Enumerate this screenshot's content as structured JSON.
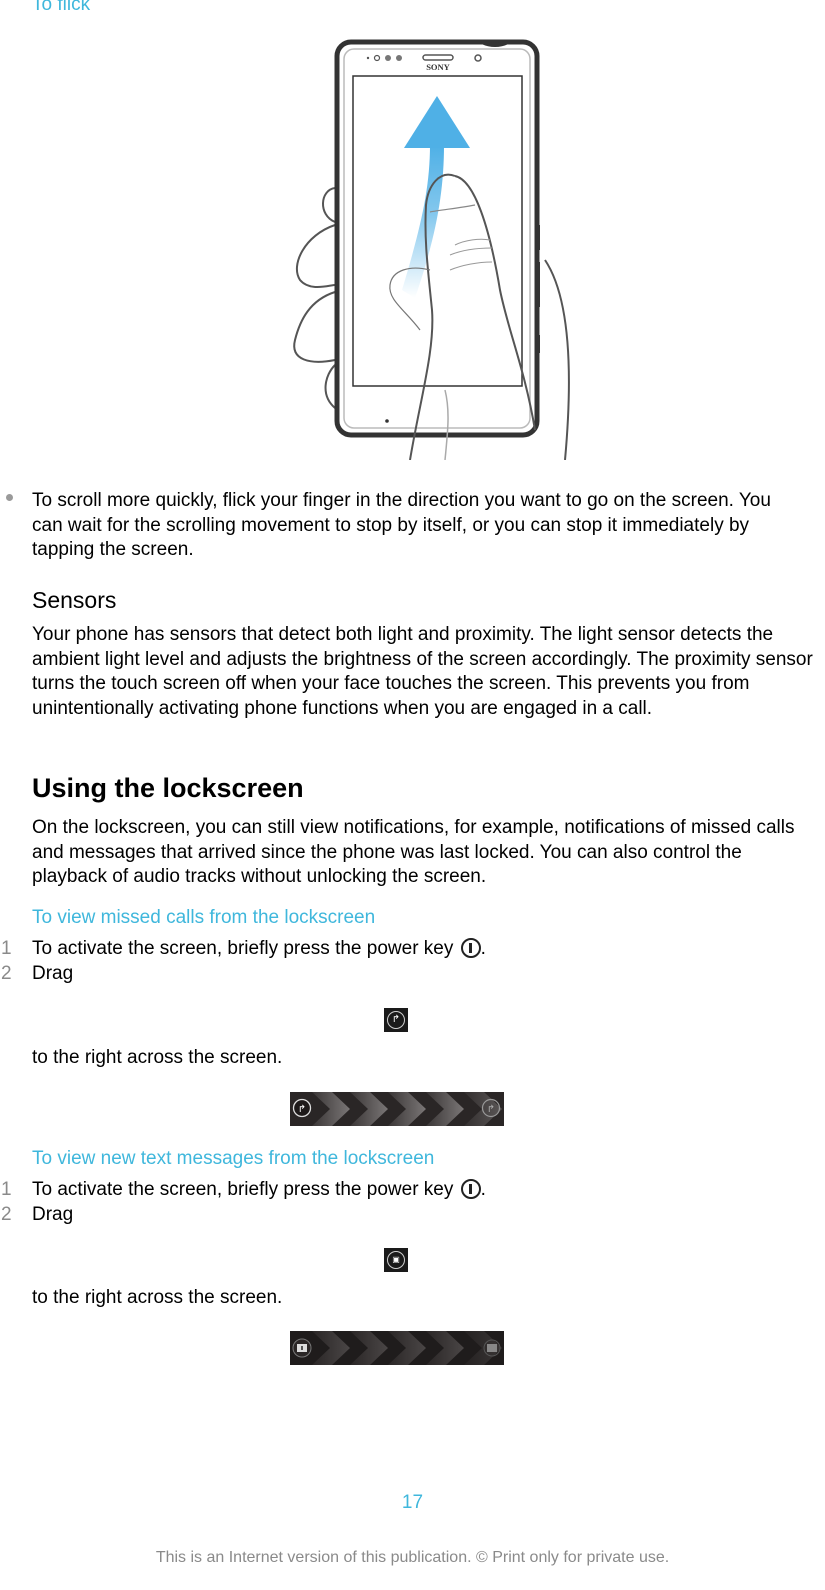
{
  "headings": {
    "to_flick": "To flick",
    "sensors": "Sensors",
    "using_lockscreen": "Using the lockscreen"
  },
  "illustration": {
    "brand_label": "SONY",
    "arrow_color": "#4fb0e6",
    "description": "Hand holding phone with finger flicking upward"
  },
  "bullets": [
    "To scroll more quickly, flick your finger in the direction you want to go on the screen. You can wait for the scrolling movement to stop by itself, or you can stop it immediately by tapping the screen."
  ],
  "paragraphs": {
    "sensors": "Your phone has sensors that detect both light and proximity. The light sensor detects the ambient light level and adjusts the brightness of the screen accordingly. The proximity sensor turns the touch screen off when your face touches the screen. This prevents you from unintentionally activating phone functions when you are engaged in a call.",
    "lockscreen": "On the lockscreen, you can still view notifications, for example, notifications of missed calls and messages that arrived since the phone was last locked. You can also control the playback of audio tracks without unlocking the screen."
  },
  "procedures": [
    {
      "title": "To view missed calls from the lockscreen",
      "steps": [
        {
          "num": "1",
          "text": "To activate the screen, briefly press the power key",
          "suffix": "."
        },
        {
          "num": "2",
          "text": "Drag"
        }
      ],
      "after_icon_text": "to the right across the screen.",
      "icon": "missed-call-icon",
      "icon_glyph": "↱"
    },
    {
      "title": "To view new text messages from the lockscreen",
      "steps": [
        {
          "num": "1",
          "text": "To activate the screen, briefly press the power key",
          "suffix": "."
        },
        {
          "num": "2",
          "text": "Drag"
        }
      ],
      "after_icon_text": "to the right across the screen.",
      "icon": "message-icon",
      "icon_glyph": "▣"
    }
  ],
  "footer": {
    "page_number": "17",
    "notice": "This is an Internet version of this publication. © Print only for private use."
  },
  "colors": {
    "heading_blue": "#3fb7dc",
    "text": "#000000",
    "muted": "#8a8a8a"
  }
}
